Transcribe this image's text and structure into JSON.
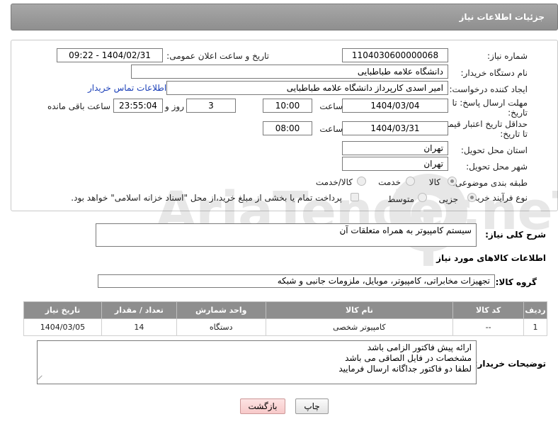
{
  "header": {
    "title": "جزئیات اطلاعات نیاز"
  },
  "fields": {
    "need_number": {
      "label": "شماره نیاز:",
      "value": "1104030600000068"
    },
    "announce_datetime": {
      "label": "تاریخ و ساعت اعلان عمومی:",
      "value": "1404/02/31 - 09:22"
    },
    "buyer_org": {
      "label": "نام دستگاه خریدار:",
      "value": "دانشگاه علامه طباطبایی"
    },
    "requester": {
      "label": "ایجاد کننده درخواست:",
      "value": "امیر اسدی کارپرداز دانشگاه علامه طباطبایی",
      "contact_link": "اطلاعات تماس خریدار"
    },
    "reply_deadline": {
      "label_line1": "مهلت ارسال پاسخ: تا",
      "label_line2": "تاریخ:",
      "date": "1404/03/04",
      "time_label": "ساعت",
      "time": "10:00",
      "days": "3",
      "days_label": "روز و",
      "remaining": "23:55:04",
      "remaining_label": "ساعت باقی مانده"
    },
    "price_validity": {
      "label_line1": "حداقل تاریخ اعتبار قیمت:",
      "label_line2": "تا تاریخ:",
      "date": "1404/03/31",
      "time_label": "ساعت",
      "time": "08:00"
    },
    "delivery_province": {
      "label": "استان محل تحویل:",
      "value": "تهران"
    },
    "delivery_city": {
      "label": "شهر محل تحویل:",
      "value": "تهران"
    },
    "category": {
      "label": "طبقه بندی موضوعی:",
      "options": [
        "کالا",
        "خدمت",
        "کالا/خدمت"
      ],
      "selected": "کالا"
    },
    "process_type": {
      "label": "نوع فرآیند خرید :",
      "options": [
        "جزیی",
        "متوسط"
      ],
      "selected": "جزیی",
      "payment_note": "پرداخت تمام یا بخشی از مبلغ خرید،از محل \"اسناد خزانه اسلامی\" خواهد بود."
    }
  },
  "description": {
    "label": "شرح کلی نیاز:",
    "value": "سیستم کامپیوتر به همراه متعلقات آن"
  },
  "goods_section": {
    "title": "اطلاعات کالاهای مورد نیاز",
    "group_label": "گروه کالا:",
    "group_value": "تجهیزات مخابراتی، کامپیوتر، موبایل، ملزومات جانبی و شبکه"
  },
  "table": {
    "headers": [
      "ردیف",
      "کد کالا",
      "نام کالا",
      "واحد شمارش",
      "تعداد / مقدار",
      "تاریخ نیاز"
    ],
    "rows": [
      [
        "1",
        "--",
        "کامپیوتر شخصی",
        "دستگاه",
        "14",
        "1404/03/05"
      ]
    ]
  },
  "buyer_notes": {
    "label": "توضیحات خریدار:",
    "lines": [
      "ارائه پیش فاکتور الزامی باشد",
      "مشخصات در فایل الصاقی می باشد",
      "لطفا دو فاکتور جداگانه ارسال فرمایید"
    ]
  },
  "watermark": {
    "text": "AriaTender.neT"
  },
  "buttons": {
    "print": "چاپ",
    "back": "بازگشت"
  },
  "colors": {
    "header_bg": "#999999",
    "table_header_bg": "#8e8e8e",
    "link": "#1a3fb8",
    "back_button_bg": "#f7c9c9"
  }
}
